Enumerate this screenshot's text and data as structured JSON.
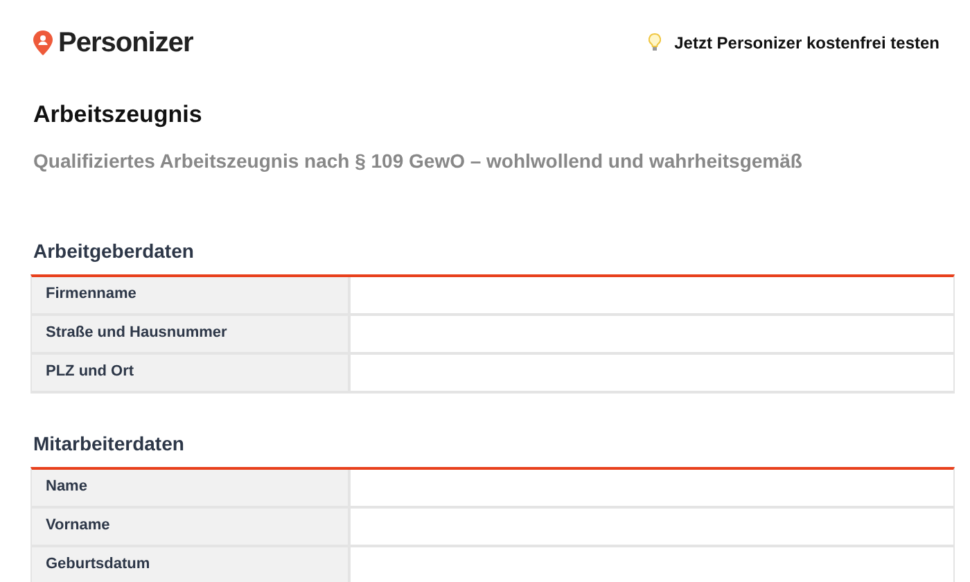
{
  "brand": {
    "name": "Personizer"
  },
  "cta": {
    "label": "Jetzt Personizer kostenfrei testen"
  },
  "title": "Arbeitszeugnis",
  "subtitle": "Qualifiziertes Arbeitszeugnis nach § 109 GewO – wohlwollend und wahrheitsgemäß",
  "sections": [
    {
      "heading": "Arbeitgeberdaten",
      "rows": [
        {
          "label": "Firmenname"
        },
        {
          "label": "Straße und Hausnummer"
        },
        {
          "label": "PLZ und Ort"
        }
      ]
    },
    {
      "heading": "Mitarbeiterdaten",
      "rows": [
        {
          "label": "Name"
        },
        {
          "label": "Vorname"
        },
        {
          "label": "Geburtsdatum"
        }
      ]
    }
  ]
}
